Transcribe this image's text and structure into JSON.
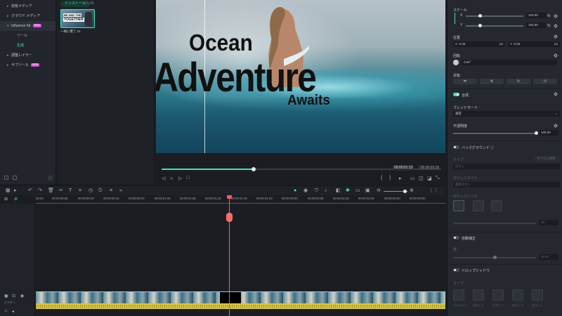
{
  "left_panel": {
    "items": [
      {
        "label": "自有メディア",
        "caret": "▸"
      },
      {
        "label": "クラウド メディア",
        "caret": "▸"
      },
      {
        "label": "Influence Kit",
        "caret": "▾",
        "badge": "NEW"
      },
      {
        "label": "ツール",
        "caret": ""
      },
      {
        "label": "生成",
        "caret": ""
      },
      {
        "label": "調整レイヤー",
        "caret": "▸"
      },
      {
        "label": "サブツール",
        "caret": "▸",
        "badge": "NEW"
      }
    ]
  },
  "media_panel": {
    "tabs": [
      "インストール",
      "いいね"
    ],
    "thumb_line1": "BE AND THE",
    "thumb_line2": "TOGETHER",
    "thumb_label": "一緒に棄て 01"
  },
  "preview": {
    "overlay_line1": "Ocean",
    "overlay_line2": "Adventure",
    "overlay_line3": "Awaits",
    "time_current": "00:00:01:13",
    "time_total": "/ 00:00:03:16",
    "progress": 0.33
  },
  "right_panel": {
    "scale_label": "スケール",
    "scale_x": "100.00",
    "scale_y": "100.00",
    "percent": "%",
    "position_label": "位置",
    "pos_x_label": "X",
    "pos_x": "0.00",
    "pos_y_label": "Y",
    "pos_y": "0.00",
    "px": "px",
    "rotate_label": "回転",
    "rotate_value": "0.00°",
    "flip_label": "反転",
    "composite_label": "合成",
    "blend_label": "ブレンドモード",
    "blend_value": "通常",
    "opacity_label": "不透明度",
    "opacity_value": "100.00",
    "background_label": "バックグラウンド",
    "type_label": "タイプ",
    "apply_all": "すべてに適用",
    "blur_label": "ぼかし",
    "blur_style_label": "ぼかしスタイル",
    "blur_style_value": "基本ぼかし",
    "blur_level_label": "ぼかしのレベル",
    "blur_level_value": "20",
    "auto_enhance_label": "自動補正",
    "amount_label": "量",
    "amount_value": "50.00",
    "drop_shadow_label": "ドロップシャドウ",
    "shadow_type_label": "タイプ",
    "shadow_presets": [
      "デフォルト",
      "ぼかし 1",
      "ぼかし 2",
      "ぼかし 3",
      "ぼかし 4"
    ]
  },
  "timeline": {
    "ticks": [
      "00:00",
      "00:00:00:05",
      "00:00:00:10",
      "00:00:00:15",
      "00:00:00:20",
      "00:00:01:00",
      "00:00:01:05",
      "00:00:01:10",
      "00:00:01:15",
      "00:00:01:20",
      "00:00:02:00",
      "00:00:02:05",
      "00:00:02:10",
      "00:00:02:15",
      "00:00:02:20",
      "00:00:03:00",
      "00:00:03:05"
    ],
    "track_label": "ビデオ 1"
  },
  "colors": {
    "accent": "#3ee6b4",
    "playhead": "#ff5b5b",
    "audio": "#d9c53a"
  }
}
